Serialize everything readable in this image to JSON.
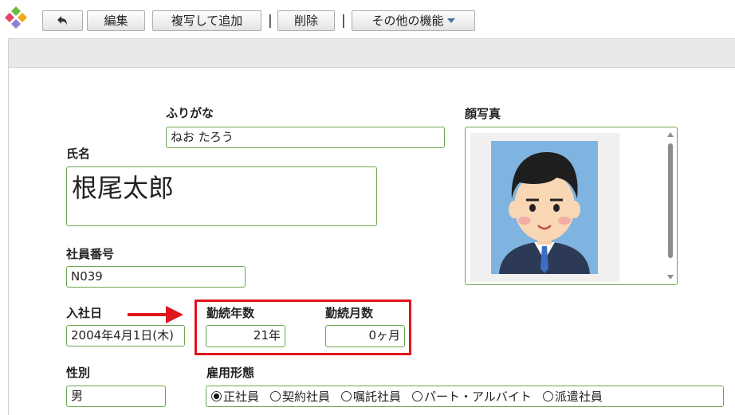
{
  "toolbar": {
    "back_label": "",
    "edit_label": "編集",
    "duplicate_label": "複写して追加",
    "delete_label": "削除",
    "more_label": "その他の機能",
    "separator": "|"
  },
  "form": {
    "furigana": {
      "label": "ふりがな",
      "value": "ねお たろう"
    },
    "name": {
      "label": "氏名",
      "value": "根尾太郎"
    },
    "employee_no": {
      "label": "社員番号",
      "value": "N039"
    },
    "hire_date": {
      "label": "入社日",
      "value": "2004年4月1日(木)"
    },
    "years": {
      "label": "勤続年数",
      "value": "21年"
    },
    "months": {
      "label": "勤続月数",
      "value": "0ヶ月"
    },
    "gender": {
      "label": "性別",
      "value": "男"
    },
    "employment_type": {
      "label": "雇用形態",
      "options": [
        "正社員",
        "契約社員",
        "嘱託社員",
        "パート・アルバイト",
        "派遣社員"
      ],
      "selected": "正社員"
    },
    "photo": {
      "label": "顔写真"
    }
  },
  "colors": {
    "field_border": "#6aa84f",
    "highlight": "#e0141b",
    "arrow": "#e0141b"
  },
  "icons": {
    "back": "back-arrow-icon",
    "more": "dropdown-caret-icon",
    "logo": "app-logo-icon"
  }
}
